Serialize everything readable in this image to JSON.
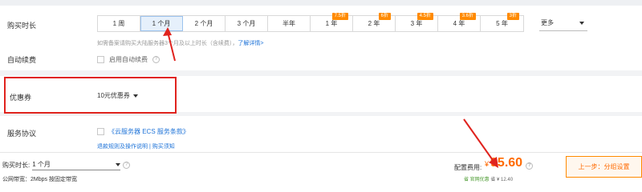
{
  "duration": {
    "label": "购买时长",
    "options": [
      {
        "label": "1 周",
        "badge": ""
      },
      {
        "label": "1 个月",
        "badge": ""
      },
      {
        "label": "2 个月",
        "badge": ""
      },
      {
        "label": "3 个月",
        "badge": ""
      },
      {
        "label": "半年",
        "badge": ""
      },
      {
        "label": "1 年",
        "badge": "7.5折"
      },
      {
        "label": "2 年",
        "badge": "6折"
      },
      {
        "label": "3 年",
        "badge": "4.5折"
      },
      {
        "label": "4 年",
        "badge": "3.6折"
      },
      {
        "label": "5 年",
        "badge": "3折"
      }
    ],
    "selected": "1 个月",
    "more_label": "更多",
    "hint_text": "如需备案请购买大陆服务器3个月及以上时长（含续费），",
    "hint_link": "了解详情>"
  },
  "auto_renew": {
    "label": "自动续费",
    "checkbox_label": "启用自动续费"
  },
  "coupon": {
    "label": "优惠券",
    "selected": "10元优惠券"
  },
  "agreement": {
    "label": "服务协议",
    "link": "《云服务器 ECS 服务条款》",
    "sub_link1": "退款规则及操作说明",
    "separator": " | ",
    "sub_link2": "购买须知"
  },
  "footer": {
    "duration_label": "购买时长:",
    "duration_value": "1 个月",
    "bandwidth_text": "公网带宽：2Mbps 按固定带宽",
    "price_label": "配置费用:",
    "currency": "¥",
    "price": "95.60",
    "saving_label": "省 官网优惠",
    "saving_amount": "省 ¥ 12.40",
    "next_button": "上一步：分组设置"
  },
  "colors": {
    "accent": "#ff6a00",
    "link": "#1e73d8",
    "annotation": "#e0231e",
    "badge": "#ff8a00"
  }
}
